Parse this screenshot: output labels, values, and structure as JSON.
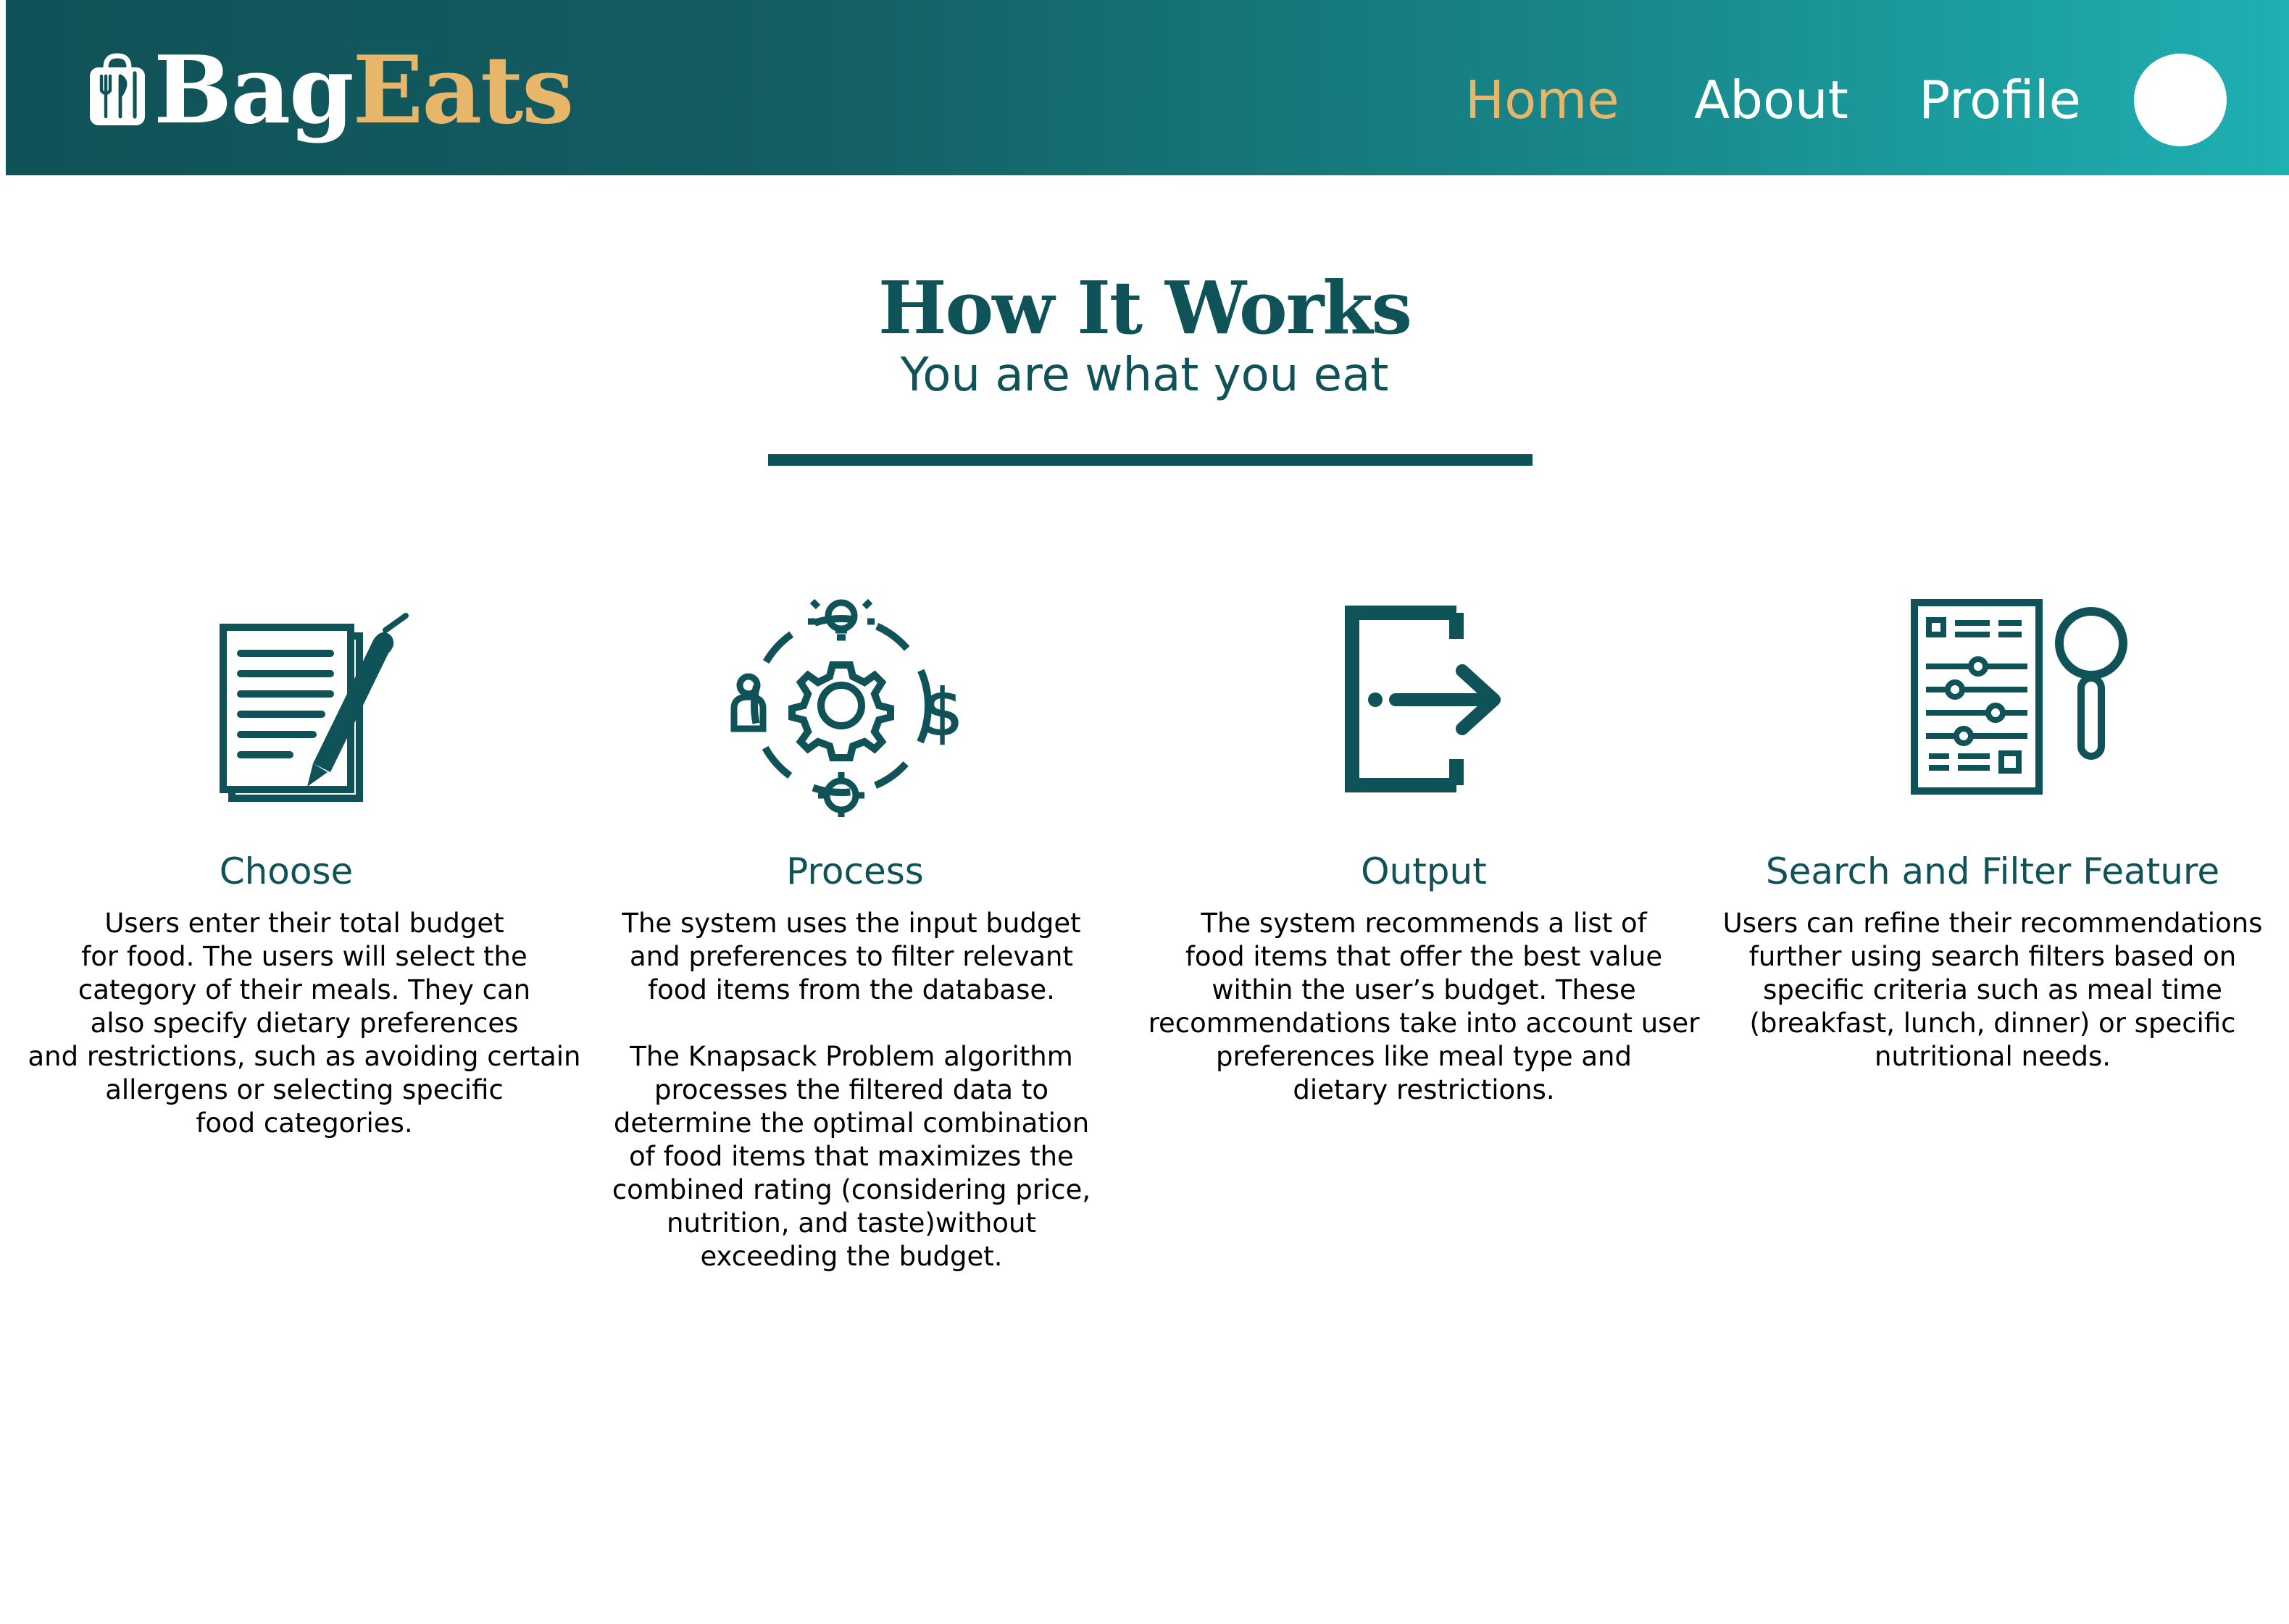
{
  "header": {
    "brand_part1": "Bag",
    "brand_part2": "Eats",
    "brand_icon": "shopping-bag-utensils-icon",
    "nav": {
      "home": "Home",
      "about": "About",
      "profile": "Profile"
    },
    "colors": {
      "gradient_start": "#0f5257",
      "gradient_end": "#1fb0b2",
      "accent": "#e8b66a"
    }
  },
  "hero": {
    "title": "How It Works",
    "subtitle": "You are what you eat"
  },
  "features": [
    {
      "title": "Choose",
      "icon": "document-pen-icon",
      "description": "Users enter their total budget\nfor food. The users will select the\ncategory of their meals. They can\nalso specify dietary preferences\nand restrictions, such as avoiding certain\nallergens or selecting specific\nfood categories."
    },
    {
      "title": "Process",
      "icon": "gear-process-icon",
      "description": "The system uses the input budget\nand preferences to filter relevant\nfood items from the database.\n\nThe Knapsack Problem algorithm\nprocesses the filtered data to\ndetermine the optimal combination\nof food items that maximizes the\ncombined rating (considering price,\nnutrition, and taste)without\nexceeding the budget."
    },
    {
      "title": "Output",
      "icon": "exit-arrow-icon",
      "description": "The system recommends a list of\nfood items that offer the best value\nwithin the user’s budget. These\nrecommendations take into account user\npreferences like meal type and\ndietary restrictions."
    },
    {
      "title": "Search and Filter Feature",
      "icon": "filter-search-icon",
      "description": "Users can refine their recommendations\nfurther using search filters based on\nspecific criteria such as meal time\n(breakfast, lunch, dinner) or specific\nnutritional needs."
    }
  ]
}
